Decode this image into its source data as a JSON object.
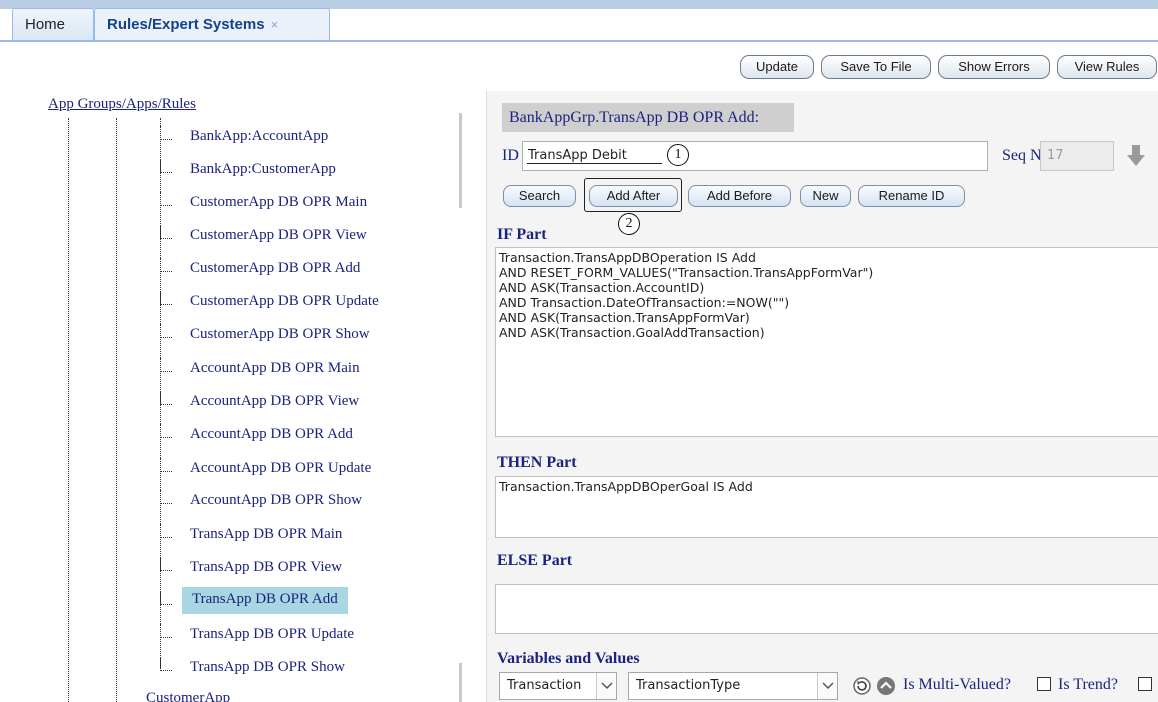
{
  "tabs": [
    {
      "label": "Home"
    },
    {
      "label": "Rules/Expert Systems",
      "close": "×"
    }
  ],
  "toolbar": {
    "update": "Update",
    "save_to_file": "Save To File",
    "show_errors": "Show Errors",
    "view_rules": "View Rules"
  },
  "tree": {
    "root": "App Groups/Apps/Rules",
    "items": [
      "BankApp:AccountApp",
      "BankApp:CustomerApp",
      "CustomerApp DB OPR Main",
      "CustomerApp DB OPR View",
      "CustomerApp DB OPR Add",
      "CustomerApp DB OPR Update",
      "CustomerApp DB OPR Show",
      "AccountApp DB OPR Main",
      "AccountApp DB OPR View",
      "AccountApp DB OPR Add",
      "AccountApp DB OPR Update",
      "AccountApp DB OPR Show",
      "TransApp DB OPR Main",
      "TransApp DB OPR View",
      "TransApp DB OPR Add",
      "TransApp DB OPR Update",
      "TransApp DB OPR Show"
    ],
    "selected": "TransApp DB OPR Add",
    "next_node": "CustomerApp"
  },
  "rule": {
    "title": "BankAppGrp.TransApp DB OPR Add:",
    "id_label": "ID",
    "id_value": "TransApp Debit",
    "seq_label": "Seq No:",
    "seq_value": "17"
  },
  "buttons": {
    "search": "Search",
    "add_after": "Add After",
    "add_before": "Add Before",
    "new": "New",
    "rename_id": "Rename ID"
  },
  "markers": {
    "one": "1",
    "two": "2"
  },
  "if_part": {
    "heading": "IF Part",
    "text": "Transaction.TransAppDBOperation IS Add\nAND RESET_FORM_VALUES(\"Transaction.TransAppFormVar\")\nAND ASK(Transaction.AccountID)\nAND Transaction.DateOfTransaction:=NOW(\"\")\nAND ASK(Transaction.TransAppFormVar)\nAND ASK(Transaction.GoalAddTransaction)"
  },
  "then_part": {
    "heading": "THEN Part",
    "text": "Transaction.TransAppDBOperGoal IS Add"
  },
  "else_part": {
    "heading": "ELSE Part",
    "text": ""
  },
  "variables": {
    "heading": "Variables and Values",
    "object_select": "Transaction",
    "variable_select": "TransactionType",
    "multi_valued_label": "Is Multi-Valued?",
    "trend_label": "Is Trend?"
  },
  "icons": [
    "down-arrow-icon",
    "refresh-icon",
    "collapse-up-icon",
    "dropdown-arrow-icon"
  ]
}
